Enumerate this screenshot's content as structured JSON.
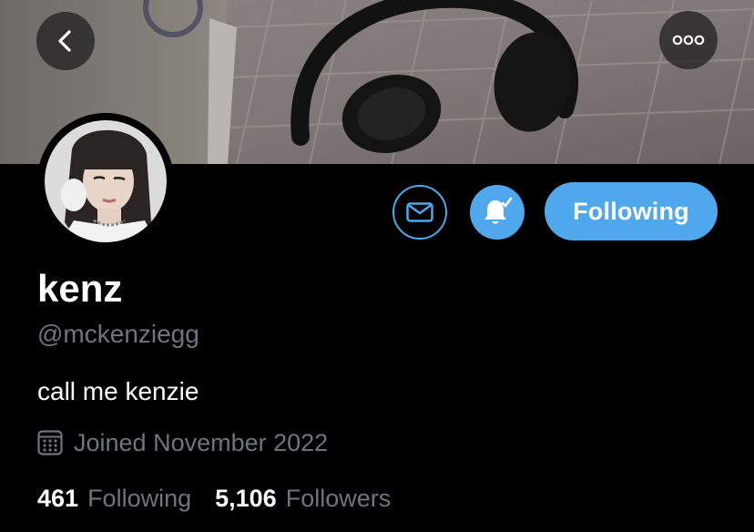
{
  "profile": {
    "display_name": "kenz",
    "handle": "@mckenziegg",
    "bio": "call me kenzie",
    "joined": "Joined November 2022"
  },
  "stats": {
    "following_count": "461",
    "following_label": "Following",
    "followers_count": "5,106",
    "followers_label": "Followers"
  },
  "actions": {
    "follow_button_label": "Following",
    "message_icon": "envelope-icon",
    "notifications_icon": "bell-check-icon",
    "back_icon": "chevron-left-icon",
    "more_icon": "more-dots-icon"
  },
  "colors": {
    "accent": "#4fa7ec",
    "background": "#000000",
    "secondary_text": "#6e767d",
    "primary_text": "#ffffff"
  }
}
